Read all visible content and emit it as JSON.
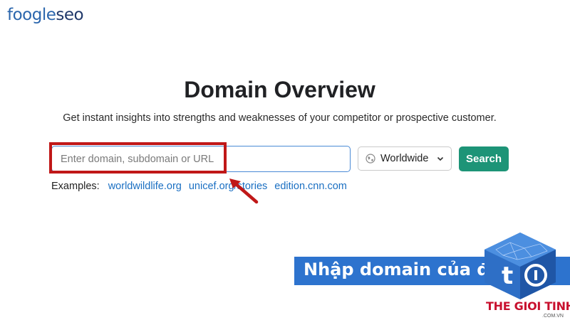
{
  "logo": {
    "brand": "foogle",
    "suffix": "seo"
  },
  "main": {
    "title": "Domain Overview",
    "subtitle": "Get instant insights into strengths and weaknesses of your competitor or prospective customer."
  },
  "search": {
    "placeholder": "Enter domain, subdomain or URL",
    "value": "",
    "region": "Worldwide",
    "button_label": "Search"
  },
  "examples": {
    "label": "Examples:",
    "items": [
      "worldwildlife.org",
      "unicef.org/stories",
      "edition.cnn.com"
    ]
  },
  "caption": {
    "text": "Nhập domain của đối thủ"
  },
  "watermark": {
    "brand": "THE GIOI TINHOC",
    "domain": ".COM.VN"
  },
  "colors": {
    "accent_button": "#1d9477",
    "link": "#1a6fc2",
    "highlight": "#c01818",
    "caption_bg": "#2d73ce"
  },
  "icons": [
    "globe-icon",
    "chevron-down-icon",
    "pointer-arrow-icon",
    "foogle-logo-icon"
  ]
}
